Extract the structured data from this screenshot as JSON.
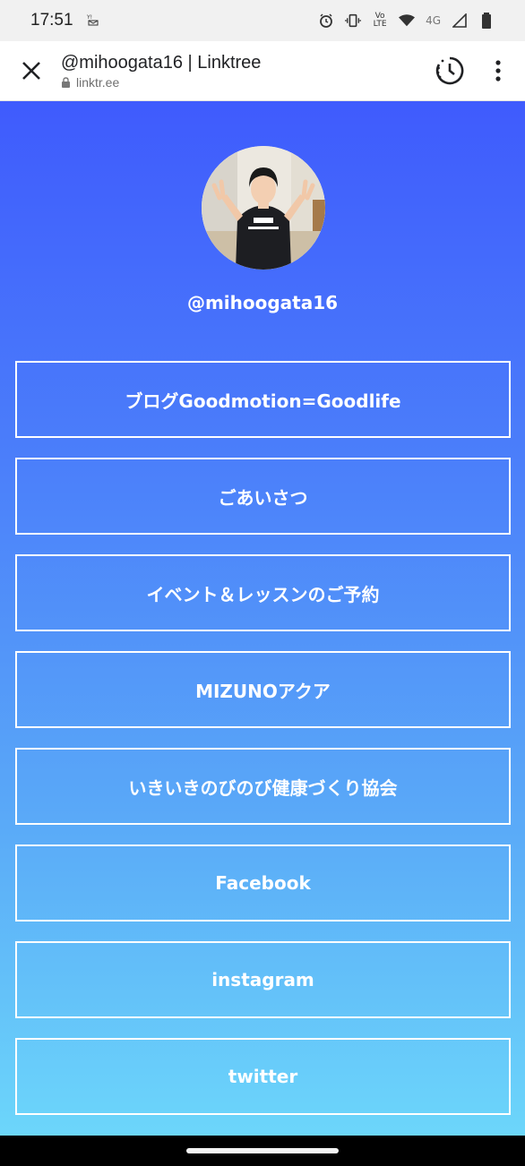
{
  "status_bar": {
    "time": "17:51",
    "notification_icon": "yahoo-mail-icon",
    "network": "4G",
    "volte": "Vo LTE",
    "icons": [
      "alarm-icon",
      "vibrate-icon",
      "volte-icon",
      "wifi-icon",
      "signal-icon",
      "battery-icon"
    ]
  },
  "toolbar": {
    "title": "@mihoogata16 | Linktree",
    "url": "linktr.ee",
    "icons": [
      "close-icon",
      "lock-icon",
      "history-icon",
      "more-vert-icon"
    ]
  },
  "profile": {
    "handle": "@mihoogata16"
  },
  "links": [
    {
      "label": "ブログGoodmotion=Goodlife"
    },
    {
      "label": "ごあいさつ"
    },
    {
      "label": "イベント＆レッスンのご予約"
    },
    {
      "label": "MIZUNOアクア"
    },
    {
      "label": "いきいきのびのび健康づくり協会"
    },
    {
      "label": "Facebook"
    },
    {
      "label": "instagram"
    },
    {
      "label": "twitter"
    }
  ],
  "colors": {
    "gradient_top": "#3f5bfd",
    "gradient_bottom": "#6cd6fa",
    "button_border": "#ffffff"
  }
}
